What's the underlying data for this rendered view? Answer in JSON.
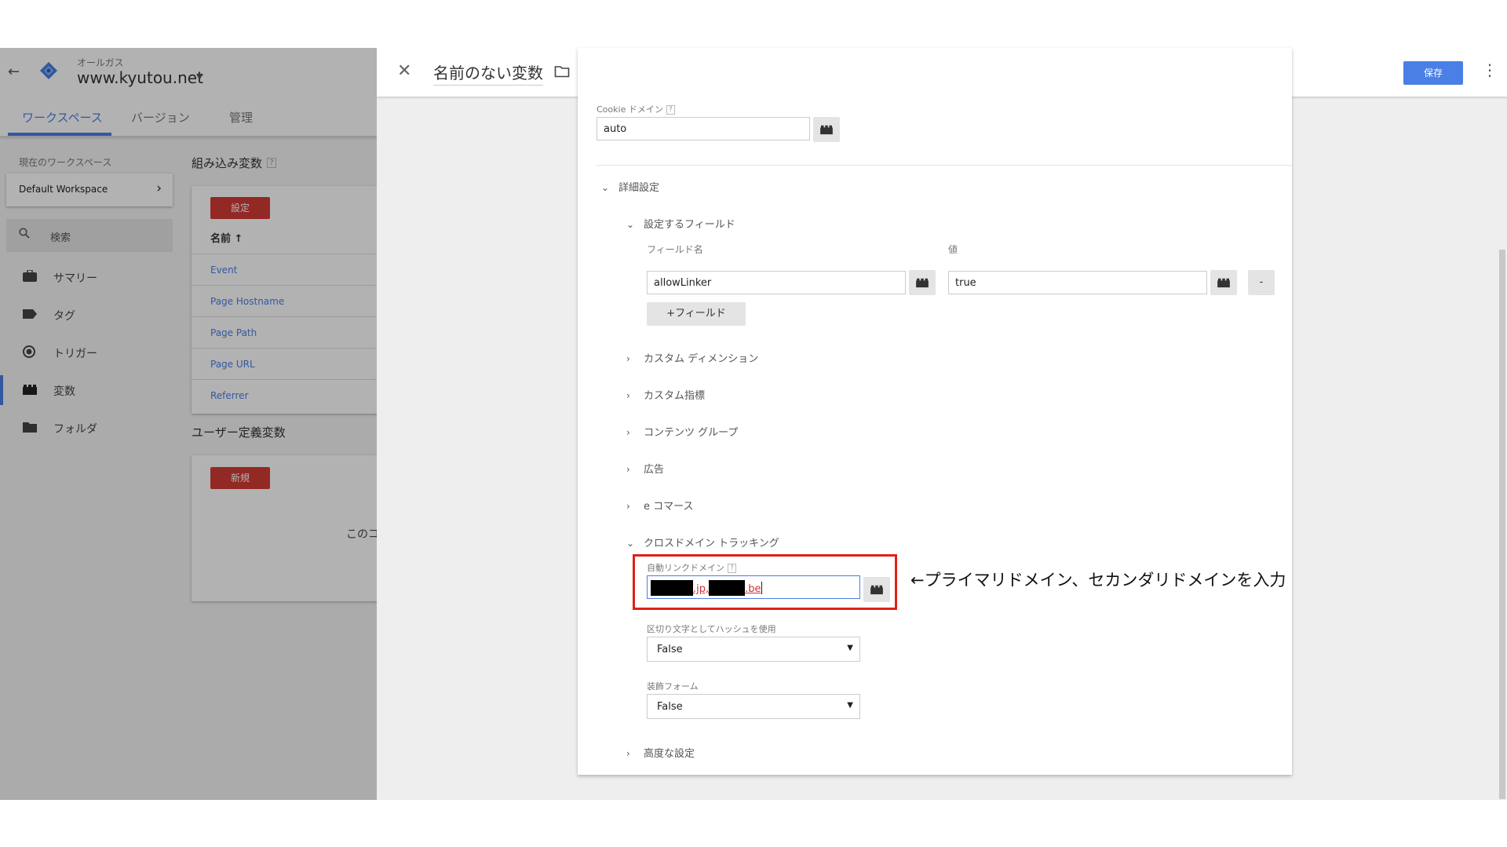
{
  "left_app": {
    "account_name": "オールガス",
    "container_name": "www.kyutou.net",
    "tabs": [
      "ワークスペース",
      "バージョン",
      "管理"
    ],
    "workspace_label": "現在のワークスペース",
    "workspace_name": "Default Workspace",
    "search_label": "検索",
    "nav": [
      "サマリー",
      "タグ",
      "トリガー",
      "変数",
      "フォルダ"
    ],
    "builtin_title": "組み込み変数",
    "config_button": "設定",
    "name_header": "名前 ↑",
    "builtin_vars": [
      "Event",
      "Page Hostname",
      "Page Path",
      "Page URL",
      "Referrer"
    ],
    "user_title": "ユーザー定義変数",
    "new_button": "新規",
    "empty_text": "このコ"
  },
  "panel": {
    "title": "名前のない変数",
    "save_button": "保存",
    "cookie_domain_label": "Cookie ドメイン",
    "cookie_domain_value": "auto",
    "advanced": "詳細設定",
    "fields_to_set": "設定するフィールド",
    "field_name_header": "フィールド名",
    "value_header": "値",
    "field_name_value": "allowLinker",
    "field_value_value": "true",
    "remove_button": "-",
    "add_field_button": "+フィールド",
    "sections": [
      "カスタム ディメンション",
      "カスタム指標",
      "コンテンツ グループ",
      "広告",
      "e コマース"
    ],
    "cross_domain": "クロスドメイン トラッキング",
    "auto_link_label": "自動リンクドメイン",
    "auto_link_parts": [
      ".jp,",
      ".be"
    ],
    "hash_label": "区切り文字としてハッシュを使用",
    "hash_value": "False",
    "decorate_label": "装飾フォーム",
    "decorate_value": "False",
    "advanced_config": "高度な設定"
  },
  "annotation": "←プライマリドメイン、セカンダリドメインを入力",
  "colors": {
    "accent_blue": "#4a7fe5",
    "red_button": "#d23b35",
    "highlight_red": "#e0201b"
  }
}
